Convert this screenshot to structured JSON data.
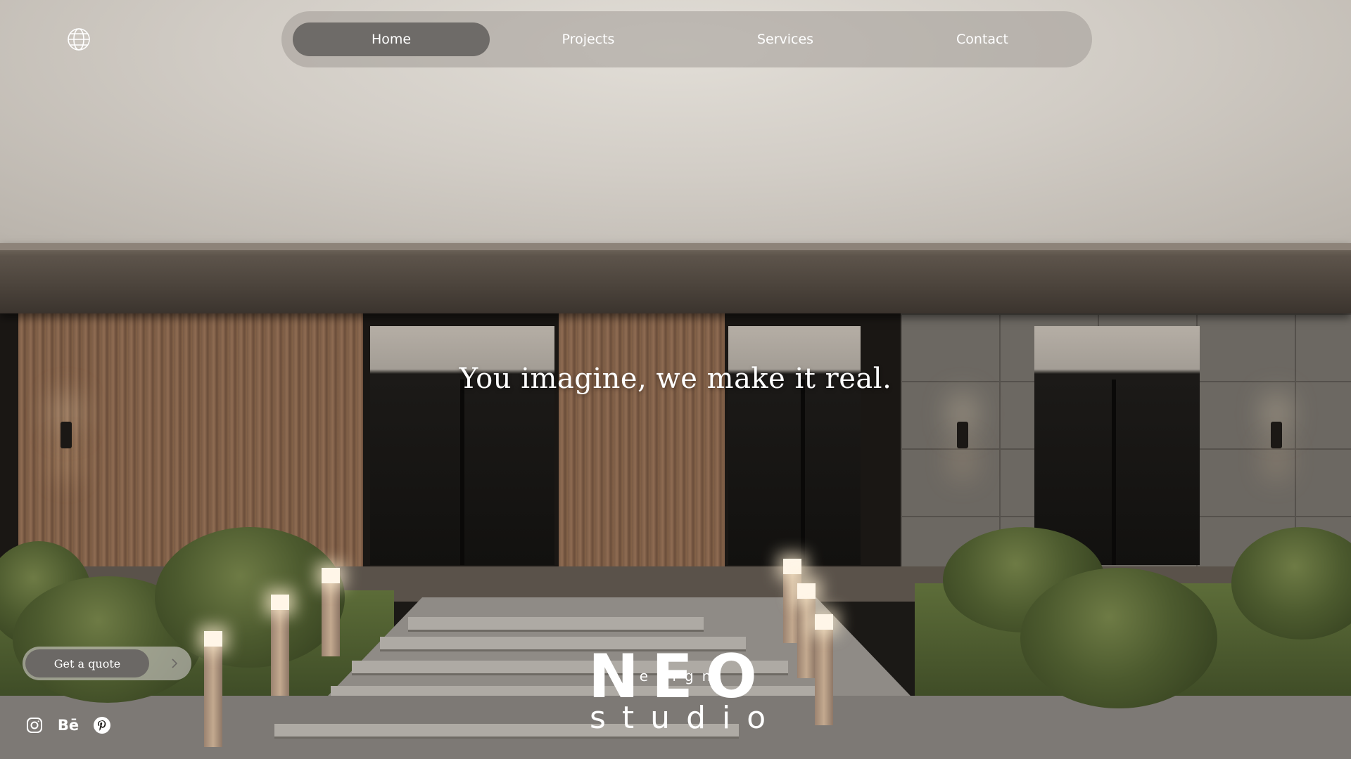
{
  "nav": {
    "items": [
      {
        "label": "Home",
        "active": true
      },
      {
        "label": "Projects",
        "active": false
      },
      {
        "label": "Services",
        "active": false
      },
      {
        "label": "Contact",
        "active": false
      }
    ],
    "language_icon": "globe-icon"
  },
  "hero": {
    "headline": "You imagine, we make it real."
  },
  "cta": {
    "label": "Get a quote",
    "arrow_icon": "chevron-right-icon"
  },
  "social": {
    "icons": [
      "instagram-icon",
      "behance-icon",
      "pinterest-icon"
    ],
    "behance_text": "Bē"
  },
  "logo": {
    "neo": "NEO",
    "design": "design",
    "studio": "studio"
  },
  "colors": {
    "nav_bar": "#a09b96",
    "nav_active": "#6e6b68",
    "cta_inner": "#6b6865",
    "text": "#ffffff"
  }
}
